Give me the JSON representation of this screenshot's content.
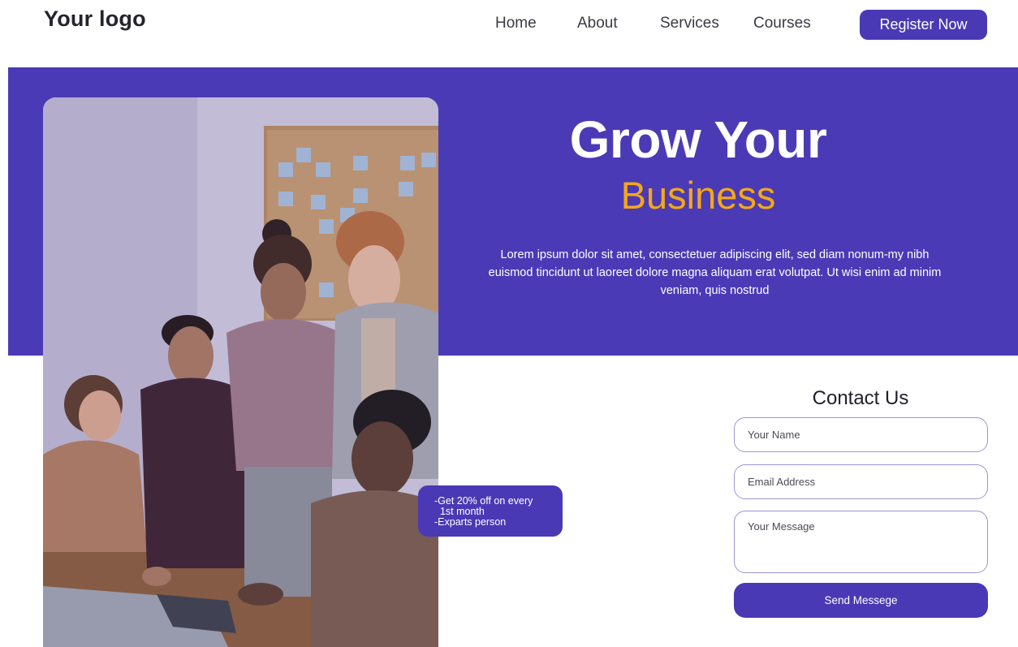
{
  "header": {
    "logo": "Your logo",
    "nav": [
      "Home",
      "About",
      "Services",
      "Courses"
    ],
    "cta": "Register Now"
  },
  "hero": {
    "title": "Grow Your",
    "subtitle": "Business",
    "body": "Lorem ipsum dolor sit amet, consectetuer adipiscing elit, sed diam nonum-my nibh euismod tincidunt ut laoreet dolore magna aliquam erat volutpat. Ut wisi enim ad minim veniam, quis nostrud"
  },
  "offer": {
    "lines": [
      "-Get 20% off on every",
      "  1st month",
      "-Exparts person"
    ]
  },
  "contact": {
    "title": "Contact Us",
    "name_placeholder": "Your Name",
    "email_placeholder": "Email Address",
    "message_placeholder": "Your Message",
    "submit": "Send Messege"
  },
  "colors": {
    "primary": "#4a39b5",
    "accent": "#f3a818",
    "background": "#ffffff"
  }
}
